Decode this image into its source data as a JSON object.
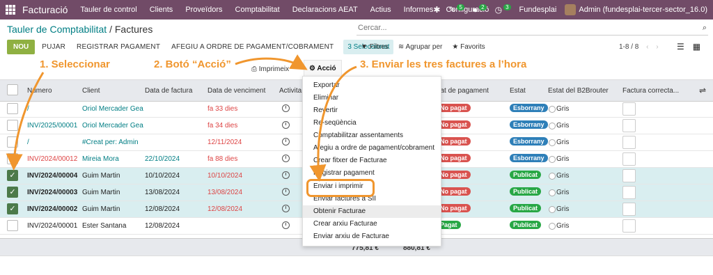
{
  "navbar": {
    "brand": "Facturació",
    "menu": [
      "Tauler de control",
      "Clients",
      "Proveïdors",
      "Comptabilitat",
      "Declaracions AEAT",
      "Actius",
      "Informes",
      "Configuració"
    ],
    "badge1": "5",
    "badge2": "2",
    "badge3": "3",
    "company": "Fundesplai",
    "user": "Admin (fundesplai-tercer-sector_16.0)"
  },
  "breadcrumb": {
    "parent": "Tauler de Comptabilitat",
    "sep": "/",
    "current": "Factures"
  },
  "search": {
    "placeholder": "Cercar..."
  },
  "toolbar": {
    "new_label": "NOU",
    "upload_label": "PUJAR",
    "register_label": "REGISTRAR PAGAMENT",
    "order_label": "AFEGIU A ORDRE DE PAGAMENT/COBRAMENT",
    "selected_label": "3 Seleccionat",
    "filters": "Filtres",
    "group": "Agrupar per",
    "favorites": "Favorits",
    "pager": "1-8 / 8",
    "print_label": "Imprimeix",
    "action_label": "Acció"
  },
  "table": {
    "headers": [
      "Número",
      "Client",
      "Data de factura",
      "Data de venciment",
      "Activita",
      "Estat de pagament",
      "Estat",
      "Estat del B2Brouter",
      "Factura correcta..."
    ],
    "rows": [
      {
        "number": "/",
        "client": "Oriol Mercader Gea",
        "date": "",
        "due": "fa 33 dies",
        "payment": "No pagat",
        "state": "Esborrany",
        "b2b": "Gris",
        "selected": false
      },
      {
        "number": "INV/2025/00001",
        "client": "Oriol Mercader Gea",
        "date": "",
        "due": "fa 34 dies",
        "payment": "No pagat",
        "state": "Esborrany",
        "b2b": "Gris",
        "selected": false
      },
      {
        "number": "/",
        "client": "#Creat per: Admin",
        "date": "",
        "due": "12/11/2024",
        "payment": "No pagat",
        "state": "Esborrany",
        "b2b": "Gris",
        "selected": false
      },
      {
        "number": "INV/2024/00012",
        "client": "Mireia Mora",
        "date": "22/10/2024",
        "due": "fa 88 dies",
        "payment": "No pagat",
        "state": "Esborrany",
        "b2b": "Gris",
        "selected": false
      },
      {
        "number": "INV/2024/00004",
        "client": "Guim Martin",
        "date": "10/10/2024",
        "due": "10/10/2024",
        "payment": "No pagat",
        "state": "Publicat",
        "b2b": "Gris",
        "selected": true
      },
      {
        "number": "INV/2024/00003",
        "client": "Guim Martin",
        "date": "13/08/2024",
        "due": "13/08/2024",
        "payment": "No pagat",
        "state": "Publicat",
        "b2b": "Gris",
        "selected": true
      },
      {
        "number": "INV/2024/00002",
        "client": "Guim Martin",
        "date": "12/08/2024",
        "due": "12/08/2024",
        "payment": "No pagat",
        "state": "Publicat",
        "b2b": "Gris",
        "selected": true
      },
      {
        "number": "INV/2024/00001",
        "client": "Ester Santana",
        "date": "12/08/2024",
        "due": "",
        "payment": "Pagat",
        "state": "Publicat",
        "b2b": "Gris",
        "selected": false
      }
    ],
    "total1": "775,81 €",
    "total2": "880,81 €"
  },
  "dropdown": {
    "items": [
      "Exportar",
      "Eliminar",
      "Revertir",
      "Re-seqüència",
      "Comptabilitzar assentaments",
      "Afegiu a ordre de pagament/cobrament",
      "Crear fitxer de Facturae",
      "Registrar pagament",
      "Enviar i imprimir",
      "Enviar factures a SII",
      "Obtenir Facturae",
      "Crear arxiu Facturae",
      "Enviar arxiu de Facturae"
    ],
    "highlighted": "Obtenir Facturae"
  },
  "annotations": {
    "step1": "1. Seleccionar",
    "step2": "2. Botó “Acció”",
    "step3": "3. Enviar les tres factures a l’hora",
    "color": "#f0962e"
  },
  "colors": {
    "navbar": "#714b67",
    "accent": "#017e84",
    "new_button": "#8fb042",
    "annotation": "#f0962e"
  }
}
